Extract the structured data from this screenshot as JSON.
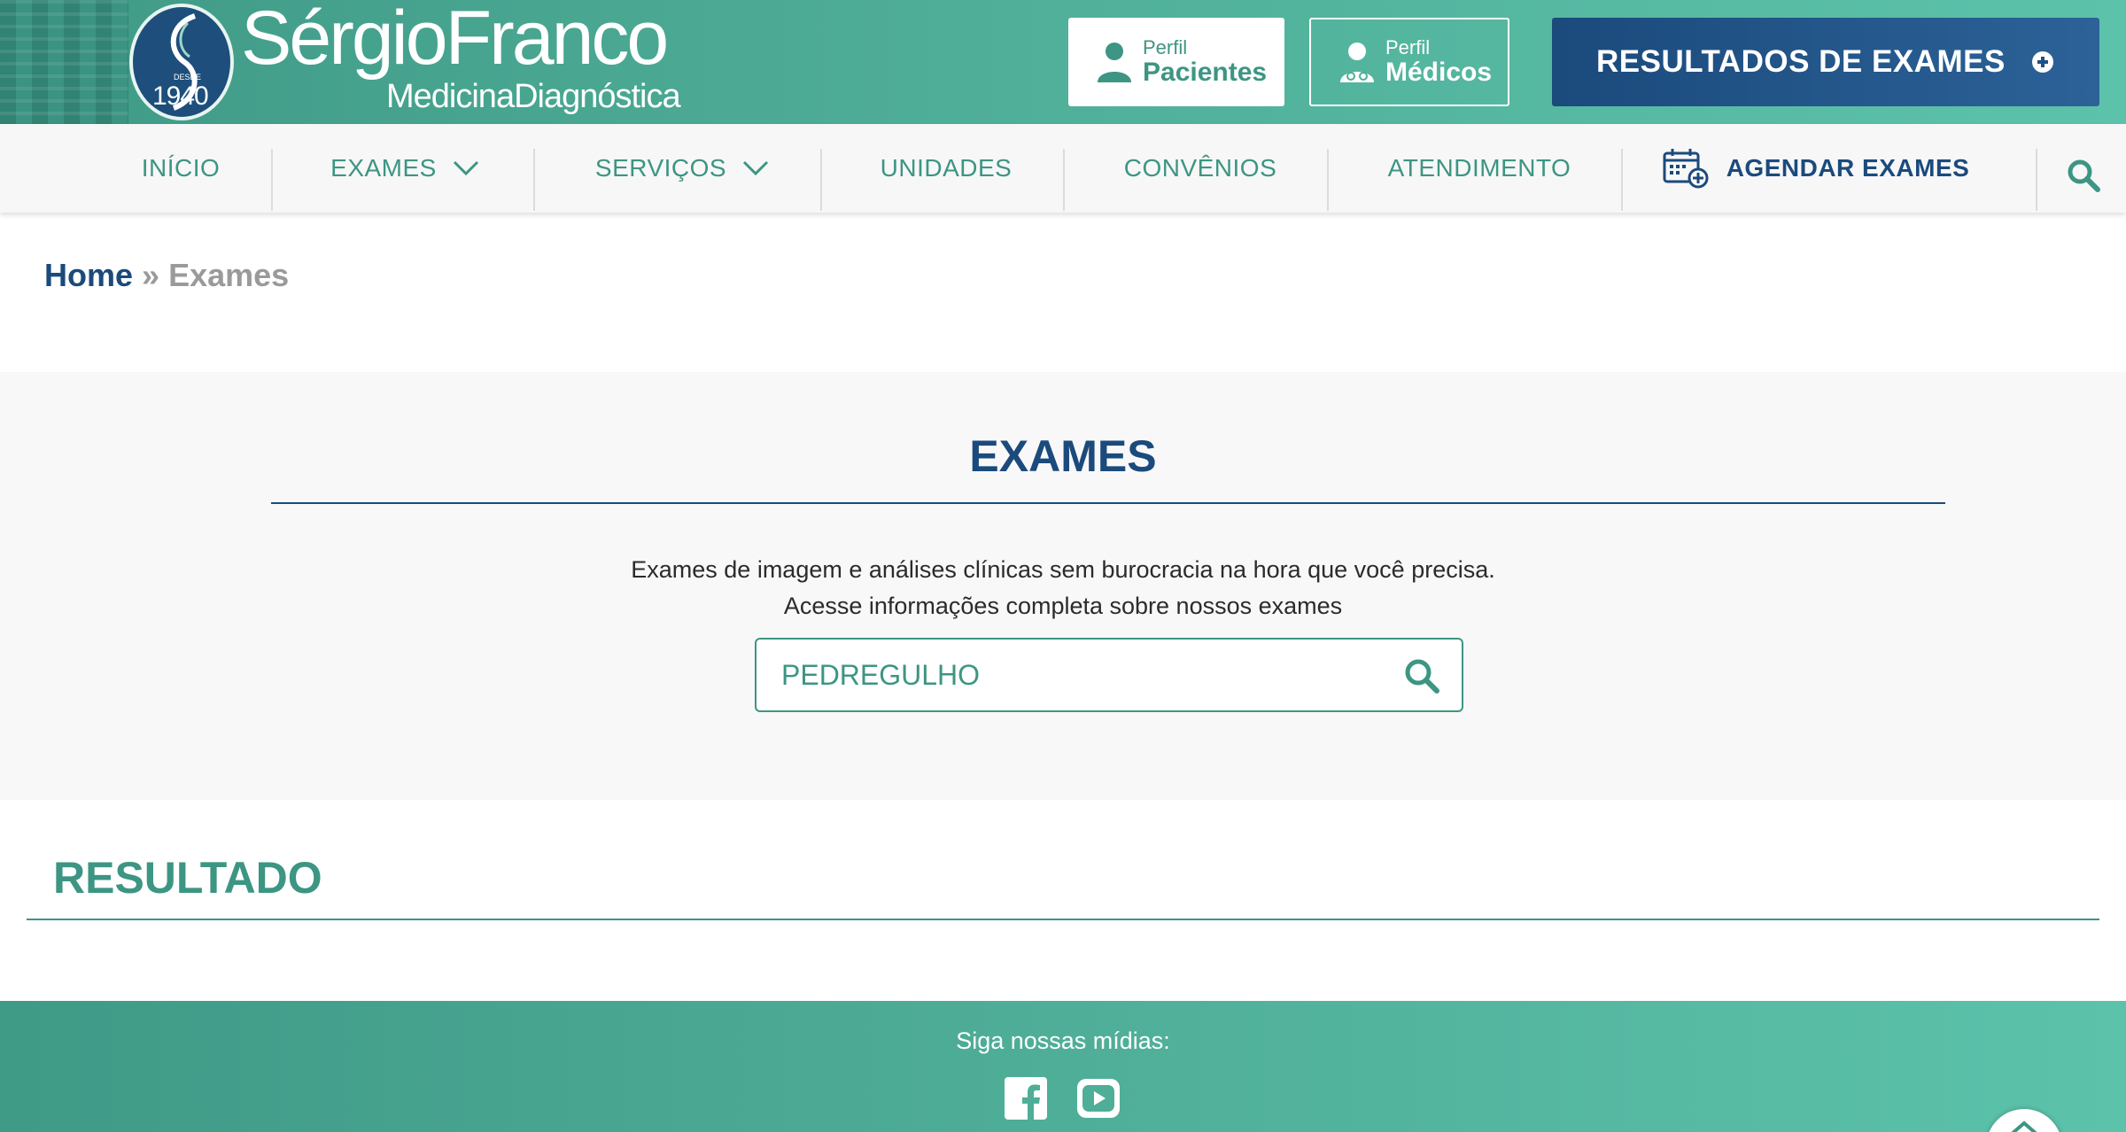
{
  "header": {
    "logo": {
      "name": "SérgioFranco",
      "subtitle": "MedicinaDiagnóstica",
      "seal_year": "1940",
      "seal_desde": "DESDE"
    },
    "profile_patients": {
      "small": "Perfil",
      "big": "Pacientes",
      "icon": "user-icon"
    },
    "profile_doctors": {
      "small": "Perfil",
      "big": "Médicos",
      "icon": "doctor-icon"
    },
    "results_button": {
      "label": "RESULTADOS DE EXAMES",
      "icon": "plus-circle-icon"
    }
  },
  "nav": {
    "items": [
      {
        "label": "INÍCIO"
      },
      {
        "label": "EXAMES",
        "dropdown": true
      },
      {
        "label": "SERVIÇOS",
        "dropdown": true
      },
      {
        "label": "UNIDADES"
      },
      {
        "label": "CONVÊNIOS"
      },
      {
        "label": "ATENDIMENTO"
      }
    ],
    "schedule": {
      "label": "AGENDAR EXAMES",
      "icon": "calendar-plus-icon"
    },
    "search_icon": "search-icon"
  },
  "breadcrumb": {
    "home": "Home",
    "separator": "»",
    "current": "Exames"
  },
  "exams": {
    "title": "EXAMES",
    "desc_line1": "Exames de imagem e análises clínicas sem burocracia na hora que você precisa.",
    "desc_line2": "Acesse informações completa sobre nossos exames",
    "search_value": "PEDREGULHO"
  },
  "result": {
    "title": "RESULTADO"
  },
  "footer": {
    "follow": "Siga nossas mídias:",
    "social": [
      "facebook-icon",
      "youtube-icon"
    ]
  },
  "colors": {
    "teal": "#3d9583",
    "navy": "#1b4a7c",
    "light_bg": "#f8f8f8"
  }
}
